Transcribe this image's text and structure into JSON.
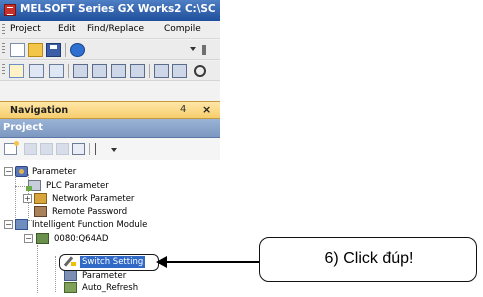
{
  "window": {
    "title": "MELSOFT Series GX Works2 C:\\SC"
  },
  "menubar": {
    "items": [
      {
        "label": "Project"
      },
      {
        "label": "Edit"
      },
      {
        "label": "Find/Replace"
      },
      {
        "label": "Compile"
      }
    ]
  },
  "navigation": {
    "title": "Navigation",
    "pin": "4",
    "close": "×",
    "project_header": "Project"
  },
  "tree": {
    "items": [
      {
        "label": "Parameter",
        "expander": "−",
        "icon": "parameter-icon"
      },
      {
        "label": "PLC Parameter",
        "icon": "plc-parameter-icon"
      },
      {
        "label": "Network Parameter",
        "expander": "+",
        "icon": "network-parameter-icon"
      },
      {
        "label": "Remote Password",
        "icon": "remote-password-icon"
      },
      {
        "label": "Intelligent Function Module",
        "expander": "−",
        "icon": "intelligent-function-module-icon"
      },
      {
        "label": "0080:Q64AD",
        "expander": "−",
        "icon": "module-icon"
      },
      {
        "label": "Switch Setting",
        "icon": "switch-setting-icon",
        "selected": true
      },
      {
        "label": "Parameter",
        "icon": "module-parameter-icon"
      },
      {
        "label": "Auto_Refresh",
        "icon": "auto-refresh-icon"
      }
    ]
  },
  "callout": {
    "text": "6) Click đúp!"
  },
  "colors": {
    "titlebar": "#1f4e9c",
    "nav_header": "#f6cd6d",
    "project_header": "#7c97c1",
    "selection": "#3169c6"
  }
}
